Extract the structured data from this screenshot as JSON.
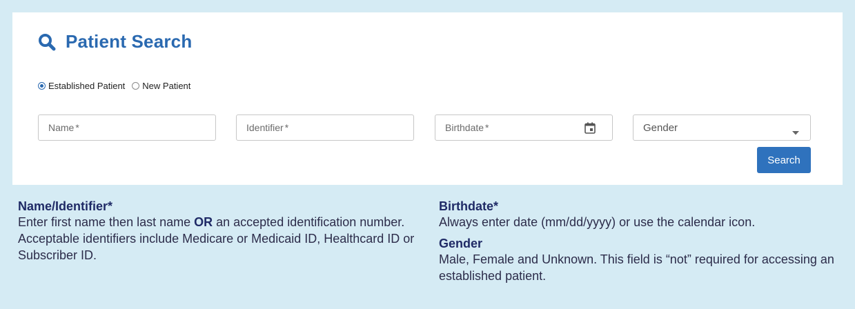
{
  "header": {
    "title": "Patient Search",
    "icon": "search-icon",
    "accent_color": "#2a69b0"
  },
  "patient_type": {
    "options": [
      {
        "label": "Established Patient",
        "selected": true
      },
      {
        "label": "New Patient",
        "selected": false
      }
    ]
  },
  "fields": {
    "name": {
      "placeholder": "Name",
      "required_mark": "*"
    },
    "identifier": {
      "placeholder": "Identifier",
      "required_mark": "*"
    },
    "birthdate": {
      "placeholder": "Birthdate",
      "required_mark": "*",
      "icon": "calendar-icon"
    },
    "gender": {
      "selected": "Gender",
      "icon": "chevron-down-icon"
    }
  },
  "search_button": {
    "label": "Search",
    "color": "#2f72bd"
  },
  "help": {
    "name_identifier": {
      "heading": "Name/Identifier*",
      "text_before": "Enter first name then last name ",
      "emphasis": "OR",
      "text_after": " an accepted identification number. Acceptable identifiers include Medicare or Medicaid ID, Healthcard ID or Subscriber ID."
    },
    "birthdate": {
      "heading": "Birthdate*",
      "text": "Always enter date (mm/dd/yyyy) or use the calendar icon."
    },
    "gender": {
      "heading": "Gender",
      "text": "Male, Female and Unknown. This field is “not” required for accessing an established patient."
    }
  },
  "colors": {
    "background": "#d5ebf4",
    "card": "#ffffff",
    "help_heading": "#1f2a66"
  }
}
